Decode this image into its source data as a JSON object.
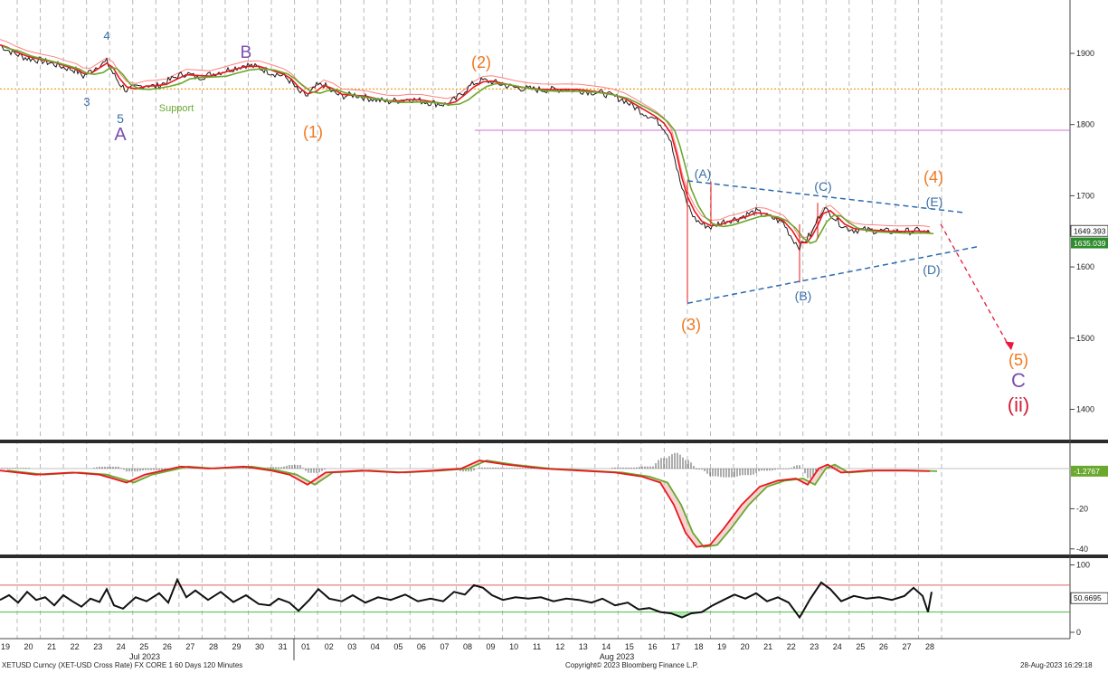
{
  "chart_data": [
    {
      "panel": "price",
      "type": "line",
      "security": "XETUSD Curncy (XET-USD Cross Rate) FX CORE 1 60 Days 120 Minutes",
      "ylim": [
        1350,
        2020
      ],
      "y_ticks": [
        1900,
        1800,
        1700,
        1600,
        1500,
        1400
      ],
      "grid": "vertical dashed per session",
      "series": [],
      "price_path": [
        [
          0,
          1912
        ],
        [
          8,
          1905
        ],
        [
          18,
          1899
        ],
        [
          30,
          1893
        ],
        [
          45,
          1890
        ],
        [
          60,
          1885
        ],
        [
          72,
          1880
        ],
        [
          84,
          1876
        ],
        [
          92,
          1868
        ],
        [
          100,
          1875
        ],
        [
          110,
          1884
        ],
        [
          118,
          1888
        ],
        [
          125,
          1872
        ],
        [
          132,
          1858
        ],
        [
          140,
          1848
        ],
        [
          150,
          1852
        ],
        [
          162,
          1856
        ],
        [
          172,
          1853
        ],
        [
          184,
          1860
        ],
        [
          196,
          1868
        ],
        [
          206,
          1872
        ],
        [
          218,
          1866
        ],
        [
          232,
          1870
        ],
        [
          246,
          1875
        ],
        [
          258,
          1879
        ],
        [
          272,
          1884
        ],
        [
          286,
          1880
        ],
        [
          300,
          1873
        ],
        [
          314,
          1868
        ],
        [
          322,
          1860
        ],
        [
          330,
          1846
        ],
        [
          340,
          1840
        ],
        [
          350,
          1854
        ],
        [
          358,
          1856
        ],
        [
          368,
          1845
        ],
        [
          378,
          1840
        ],
        [
          392,
          1842
        ],
        [
          404,
          1838
        ],
        [
          416,
          1835
        ],
        [
          428,
          1832
        ],
        [
          440,
          1834
        ],
        [
          452,
          1836
        ],
        [
          466,
          1833
        ],
        [
          480,
          1830
        ],
        [
          494,
          1828
        ],
        [
          504,
          1836
        ],
        [
          514,
          1848
        ],
        [
          524,
          1858
        ],
        [
          534,
          1862
        ],
        [
          544,
          1860
        ],
        [
          556,
          1856
        ],
        [
          570,
          1852
        ],
        [
          584,
          1850
        ],
        [
          598,
          1849
        ],
        [
          612,
          1849
        ],
        [
          626,
          1850
        ],
        [
          640,
          1848
        ],
        [
          654,
          1846
        ],
        [
          666,
          1844
        ],
        [
          678,
          1840
        ],
        [
          690,
          1834
        ],
        [
          700,
          1826
        ],
        [
          712,
          1816
        ],
        [
          724,
          1808
        ],
        [
          734,
          1796
        ],
        [
          742,
          1778
        ],
        [
          748,
          1740
        ],
        [
          754,
          1710
        ],
        [
          760,
          1688
        ],
        [
          768,
          1668
        ],
        [
          776,
          1660
        ],
        [
          786,
          1656
        ],
        [
          796,
          1662
        ],
        [
          806,
          1666
        ],
        [
          816,
          1668
        ],
        [
          826,
          1674
        ],
        [
          836,
          1678
        ],
        [
          846,
          1672
        ],
        [
          856,
          1668
        ],
        [
          866,
          1662
        ],
        [
          876,
          1640
        ],
        [
          884,
          1628
        ],
        [
          892,
          1640
        ],
        [
          898,
          1648
        ],
        [
          904,
          1668
        ],
        [
          910,
          1682
        ],
        [
          918,
          1676
        ],
        [
          926,
          1664
        ],
        [
          934,
          1656
        ],
        [
          944,
          1652
        ],
        [
          956,
          1652
        ],
        [
          968,
          1651
        ],
        [
          980,
          1650
        ],
        [
          992,
          1650
        ],
        [
          1004,
          1650
        ],
        [
          1014,
          1651
        ],
        [
          1022,
          1649
        ],
        [
          1028,
          1648
        ]
      ],
      "last_value": "1649.393",
      "last_value_2": "1635.039",
      "horizontal_lines": [
        {
          "y": 1850,
          "color": "#f0a020",
          "style": "dotted",
          "label": "Support"
        },
        {
          "y": 1792,
          "color": "#d070d0",
          "style": "solid"
        }
      ],
      "wave_labels": [
        {
          "text": "4",
          "color": "#3a6ea8"
        },
        {
          "text": "B",
          "color": "#7a4fb0"
        },
        {
          "text": "3",
          "color": "#3a6ea8"
        },
        {
          "text": "5",
          "color": "#3a6ea8"
        },
        {
          "text": "A",
          "color": "#7a4fb0"
        },
        {
          "text": "Support",
          "color": "#6aa82e"
        },
        {
          "text": "(2)",
          "color": "#f07820"
        },
        {
          "text": "(1)",
          "color": "#f07820"
        },
        {
          "text": "(A)",
          "color": "#3a6ea8"
        },
        {
          "text": "(C)",
          "color": "#3a6ea8"
        },
        {
          "text": "(E)",
          "color": "#3a6ea8"
        },
        {
          "text": "(4)",
          "color": "#f07820"
        },
        {
          "text": "(D)",
          "color": "#3a6ea8"
        },
        {
          "text": "(B)",
          "color": "#3a6ea8"
        },
        {
          "text": "(3)",
          "color": "#f07820"
        },
        {
          "text": "(5)",
          "color": "#f07820"
        },
        {
          "text": "C",
          "color": "#7a4fb0"
        },
        {
          "text": "(ii)",
          "color": "#d0203a"
        }
      ]
    },
    {
      "panel": "oscillator",
      "type": "line",
      "ylim": [
        -42,
        10
      ],
      "y_ticks": [
        "-20",
        "-40"
      ],
      "last_value": "-1.2767",
      "series": [],
      "osc_path": [
        [
          0,
          -1
        ],
        [
          40,
          -3
        ],
        [
          80,
          -2
        ],
        [
          110,
          -3
        ],
        [
          140,
          -7
        ],
        [
          160,
          -3
        ],
        [
          200,
          1
        ],
        [
          230,
          0
        ],
        [
          270,
          1
        ],
        [
          300,
          -1
        ],
        [
          320,
          -3
        ],
        [
          340,
          -8
        ],
        [
          360,
          -2
        ],
        [
          400,
          -1
        ],
        [
          440,
          -2
        ],
        [
          480,
          -1
        ],
        [
          510,
          0
        ],
        [
          530,
          4
        ],
        [
          560,
          2
        ],
        [
          600,
          0
        ],
        [
          640,
          -1
        ],
        [
          680,
          -2
        ],
        [
          710,
          -4
        ],
        [
          730,
          -7
        ],
        [
          745,
          -18
        ],
        [
          758,
          -32
        ],
        [
          770,
          -39
        ],
        [
          785,
          -38
        ],
        [
          800,
          -30
        ],
        [
          820,
          -18
        ],
        [
          840,
          -9
        ],
        [
          860,
          -6
        ],
        [
          880,
          -5
        ],
        [
          893,
          -8
        ],
        [
          905,
          0
        ],
        [
          915,
          2
        ],
        [
          930,
          -2
        ],
        [
          960,
          -1
        ],
        [
          1000,
          -1
        ],
        [
          1028,
          -1.3
        ]
      ]
    },
    {
      "panel": "rsi",
      "type": "line",
      "ylim": [
        -5,
        105
      ],
      "y_ticks": [
        "100",
        "0"
      ],
      "overbought": 70,
      "oversold": 30,
      "last_value": "50.6695",
      "rsi_path": [
        [
          0,
          48
        ],
        [
          10,
          55
        ],
        [
          20,
          44
        ],
        [
          30,
          60
        ],
        [
          40,
          48
        ],
        [
          50,
          52
        ],
        [
          60,
          40
        ],
        [
          70,
          55
        ],
        [
          80,
          46
        ],
        [
          90,
          38
        ],
        [
          100,
          50
        ],
        [
          110,
          45
        ],
        [
          118,
          64
        ],
        [
          126,
          40
        ],
        [
          136,
          35
        ],
        [
          150,
          52
        ],
        [
          162,
          46
        ],
        [
          176,
          58
        ],
        [
          186,
          44
        ],
        [
          196,
          78
        ],
        [
          206,
          52
        ],
        [
          216,
          62
        ],
        [
          230,
          48
        ],
        [
          244,
          60
        ],
        [
          258,
          45
        ],
        [
          272,
          55
        ],
        [
          286,
          42
        ],
        [
          298,
          40
        ],
        [
          308,
          50
        ],
        [
          320,
          44
        ],
        [
          330,
          32
        ],
        [
          342,
          48
        ],
        [
          352,
          64
        ],
        [
          364,
          50
        ],
        [
          378,
          46
        ],
        [
          390,
          55
        ],
        [
          404,
          44
        ],
        [
          418,
          52
        ],
        [
          432,
          48
        ],
        [
          448,
          56
        ],
        [
          462,
          46
        ],
        [
          476,
          50
        ],
        [
          490,
          46
        ],
        [
          502,
          60
        ],
        [
          514,
          56
        ],
        [
          524,
          70
        ],
        [
          534,
          66
        ],
        [
          544,
          55
        ],
        [
          556,
          48
        ],
        [
          570,
          52
        ],
        [
          584,
          50
        ],
        [
          598,
          52
        ],
        [
          612,
          46
        ],
        [
          626,
          50
        ],
        [
          640,
          48
        ],
        [
          654,
          44
        ],
        [
          666,
          50
        ],
        [
          680,
          40
        ],
        [
          694,
          44
        ],
        [
          706,
          34
        ],
        [
          718,
          36
        ],
        [
          730,
          30
        ],
        [
          742,
          28
        ],
        [
          754,
          22
        ],
        [
          764,
          28
        ],
        [
          776,
          30
        ],
        [
          788,
          40
        ],
        [
          800,
          48
        ],
        [
          812,
          56
        ],
        [
          824,
          50
        ],
        [
          836,
          58
        ],
        [
          848,
          46
        ],
        [
          860,
          52
        ],
        [
          872,
          44
        ],
        [
          884,
          22
        ],
        [
          896,
          50
        ],
        [
          908,
          74
        ],
        [
          918,
          64
        ],
        [
          930,
          46
        ],
        [
          944,
          54
        ],
        [
          958,
          50
        ],
        [
          972,
          52
        ],
        [
          986,
          48
        ],
        [
          1000,
          54
        ],
        [
          1010,
          66
        ],
        [
          1020,
          54
        ],
        [
          1026,
          30
        ],
        [
          1030,
          60
        ]
      ]
    }
  ],
  "x_axis": {
    "days": [
      "19",
      "20",
      "21",
      "22",
      "23",
      "24",
      "25",
      "26",
      "27",
      "28",
      "29",
      "30",
      "31",
      "01",
      "02",
      "03",
      "04",
      "05",
      "06",
      "07",
      "08",
      "09",
      "10",
      "11",
      "12",
      "13",
      "14",
      "15",
      "16",
      "17",
      "18",
      "19",
      "20",
      "21",
      "22",
      "23",
      "24",
      "25",
      "26",
      "27",
      "28"
    ],
    "months": [
      "Jul 2023",
      "Aug 2023"
    ]
  },
  "footer": {
    "left": "XETUSD Curncy (XET-USD Cross Rate) FX CORE 1 60 Days 120 Minutes",
    "center": "Copyright© 2023 Bloomberg Finance L.P.",
    "right": "28-Aug-2023 16:29:18"
  },
  "colors": {
    "price": "#1a1a1a",
    "fast_ma": "#e8181e",
    "slow_ma": "#6aa82e",
    "pink_ma": "#ff8080",
    "trend": "#2a6ab0",
    "projection": "#e8183e"
  }
}
